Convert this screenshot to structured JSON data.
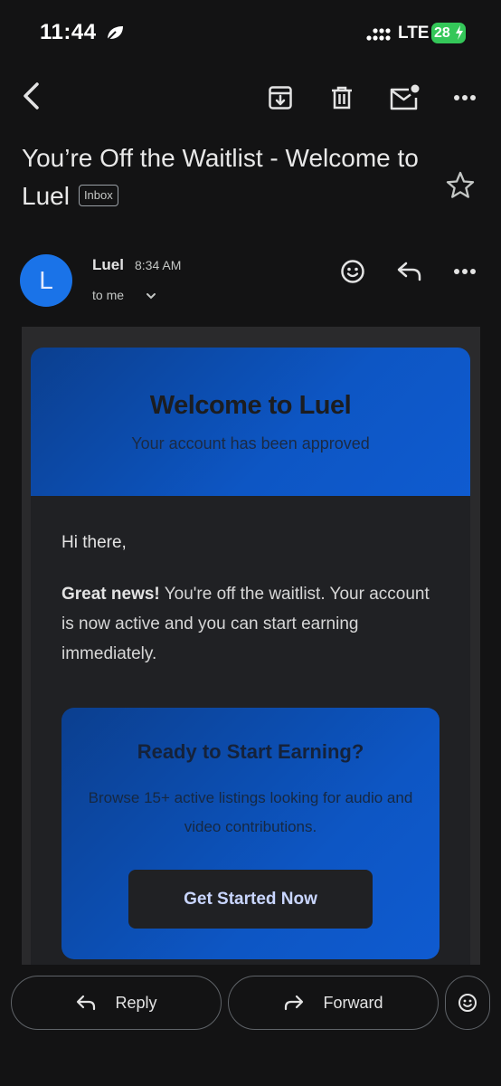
{
  "status_bar": {
    "time": "11:44",
    "network": "LTE",
    "battery": "28"
  },
  "email": {
    "subject": "You’re Off the Waitlist - Welcome to Luel",
    "label": "Inbox",
    "sender_initial": "L",
    "sender_name": "Luel",
    "time": "8:34 AM",
    "recipient": "to me"
  },
  "content": {
    "hero_title": "Welcome to Luel",
    "hero_subtitle": "Your account has been approved",
    "greeting": "Hi there,",
    "para_bold": "Great news!",
    "para_rest": " You're off the waitlist. Your account is now active and you can start earning immediately.",
    "cta_title": "Ready to Start Earning?",
    "cta_text": "Browse 15+ active listings looking for audio and video contributions.",
    "cta_button": "Get Started Now"
  },
  "actions": {
    "reply": "Reply",
    "forward": "Forward"
  },
  "colors": {
    "background": "#131314",
    "accent": "#1a73e8",
    "hero_blue": "#0d56c4",
    "battery": "#34c759"
  }
}
